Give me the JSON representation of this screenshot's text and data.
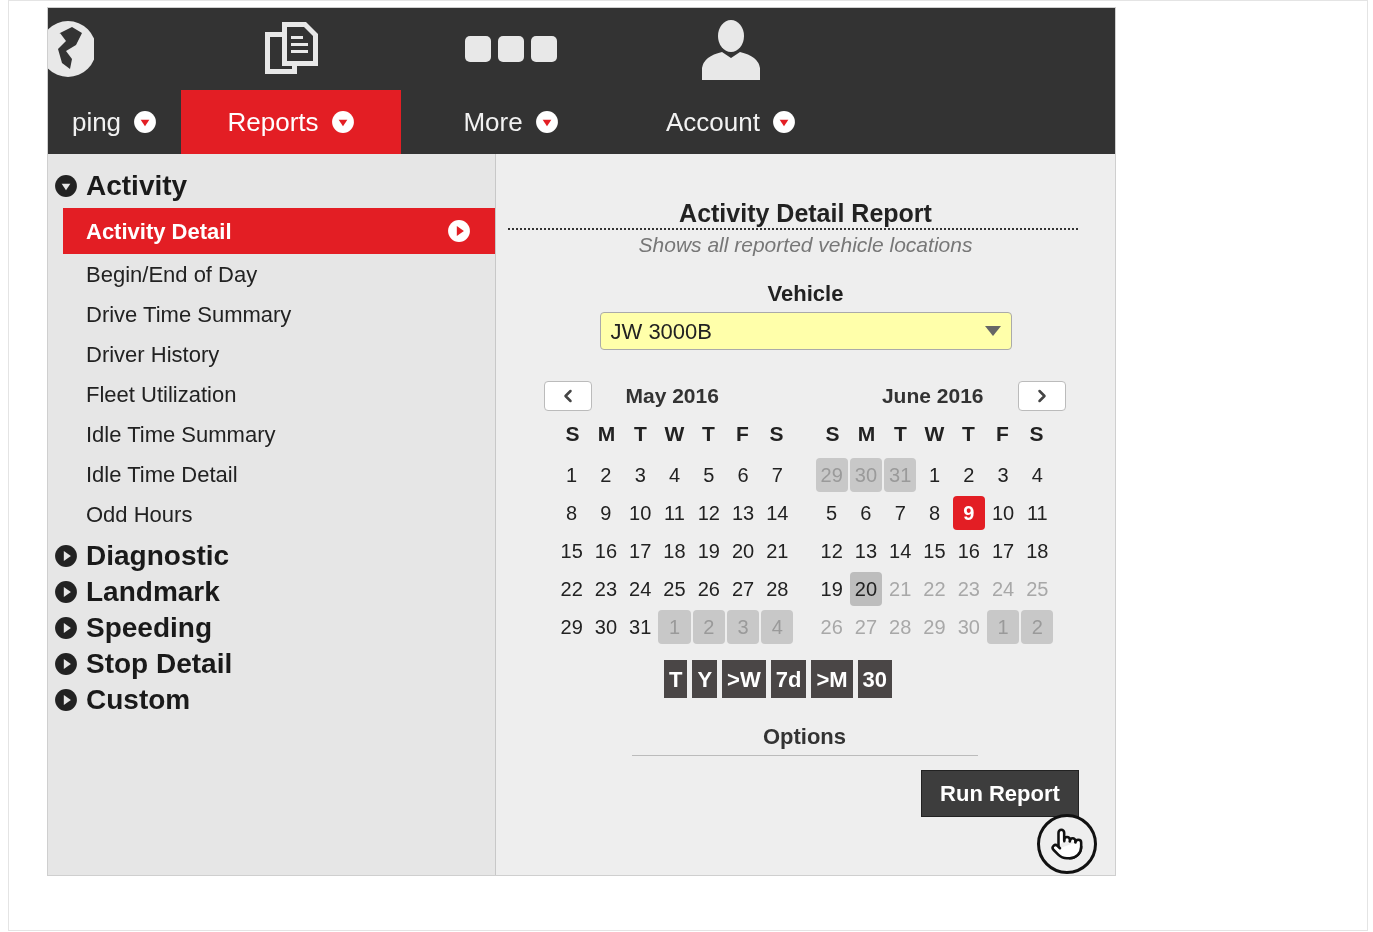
{
  "nav": [
    {
      "label": "ping",
      "selected": false
    },
    {
      "label": "Reports",
      "selected": true
    },
    {
      "label": "More",
      "selected": false
    },
    {
      "label": "Account",
      "selected": false
    }
  ],
  "sidebar": [
    {
      "label": "Activity",
      "expanded": true,
      "children": [
        {
          "label": "Activity Detail",
          "selected": true
        },
        {
          "label": "Begin/End of Day",
          "selected": false
        },
        {
          "label": "Drive Time Summary",
          "selected": false
        },
        {
          "label": "Driver History",
          "selected": false
        },
        {
          "label": "Fleet Utilization",
          "selected": false
        },
        {
          "label": "Idle Time Summary",
          "selected": false
        },
        {
          "label": "Idle Time Detail",
          "selected": false
        },
        {
          "label": "Odd Hours",
          "selected": false
        }
      ]
    },
    {
      "label": "Diagnostic",
      "expanded": false
    },
    {
      "label": "Landmark",
      "expanded": false
    },
    {
      "label": "Speeding",
      "expanded": false
    },
    {
      "label": "Stop Detail",
      "expanded": false
    },
    {
      "label": "Custom",
      "expanded": false
    }
  ],
  "report": {
    "title": "Activity Detail Report",
    "subtitle": "Shows all reported vehicle locations",
    "vehicle_label": "Vehicle",
    "vehicle_value": "JW 3000B"
  },
  "calendar": {
    "months": [
      {
        "title": "May 2016",
        "weekdays": [
          "S",
          "M",
          "T",
          "W",
          "T",
          "F",
          "S"
        ],
        "weeks": [
          [
            {
              "day": "1",
              "kind": "normal"
            },
            {
              "day": "2",
              "kind": "normal"
            },
            {
              "day": "3",
              "kind": "normal"
            },
            {
              "day": "4",
              "kind": "normal"
            },
            {
              "day": "5",
              "kind": "normal"
            },
            {
              "day": "6",
              "kind": "normal"
            },
            {
              "day": "7",
              "kind": "normal"
            }
          ],
          [
            {
              "day": "8",
              "kind": "normal"
            },
            {
              "day": "9",
              "kind": "normal"
            },
            {
              "day": "10",
              "kind": "normal"
            },
            {
              "day": "11",
              "kind": "normal"
            },
            {
              "day": "12",
              "kind": "normal"
            },
            {
              "day": "13",
              "kind": "normal"
            },
            {
              "day": "14",
              "kind": "normal"
            }
          ],
          [
            {
              "day": "15",
              "kind": "normal"
            },
            {
              "day": "16",
              "kind": "normal"
            },
            {
              "day": "17",
              "kind": "normal"
            },
            {
              "day": "18",
              "kind": "normal"
            },
            {
              "day": "19",
              "kind": "normal"
            },
            {
              "day": "20",
              "kind": "normal"
            },
            {
              "day": "21",
              "kind": "normal"
            }
          ],
          [
            {
              "day": "22",
              "kind": "normal"
            },
            {
              "day": "23",
              "kind": "normal"
            },
            {
              "day": "24",
              "kind": "normal"
            },
            {
              "day": "25",
              "kind": "normal"
            },
            {
              "day": "26",
              "kind": "normal"
            },
            {
              "day": "27",
              "kind": "normal"
            },
            {
              "day": "28",
              "kind": "normal"
            }
          ],
          [
            {
              "day": "29",
              "kind": "normal"
            },
            {
              "day": "30",
              "kind": "normal"
            },
            {
              "day": "31",
              "kind": "normal"
            },
            {
              "day": "1",
              "kind": "other"
            },
            {
              "day": "2",
              "kind": "other"
            },
            {
              "day": "3",
              "kind": "other"
            },
            {
              "day": "4",
              "kind": "other"
            }
          ]
        ]
      },
      {
        "title": "June 2016",
        "weekdays": [
          "S",
          "M",
          "T",
          "W",
          "T",
          "F",
          "S"
        ],
        "weeks": [
          [
            {
              "day": "29",
              "kind": "other"
            },
            {
              "day": "30",
              "kind": "other"
            },
            {
              "day": "31",
              "kind": "other"
            },
            {
              "day": "1",
              "kind": "normal"
            },
            {
              "day": "2",
              "kind": "normal"
            },
            {
              "day": "3",
              "kind": "normal"
            },
            {
              "day": "4",
              "kind": "normal"
            }
          ],
          [
            {
              "day": "5",
              "kind": "normal"
            },
            {
              "day": "6",
              "kind": "normal"
            },
            {
              "day": "7",
              "kind": "normal"
            },
            {
              "day": "8",
              "kind": "normal"
            },
            {
              "day": "9",
              "kind": "selected"
            },
            {
              "day": "10",
              "kind": "normal"
            },
            {
              "day": "11",
              "kind": "normal"
            }
          ],
          [
            {
              "day": "12",
              "kind": "normal"
            },
            {
              "day": "13",
              "kind": "normal"
            },
            {
              "day": "14",
              "kind": "normal"
            },
            {
              "day": "15",
              "kind": "normal"
            },
            {
              "day": "16",
              "kind": "normal"
            },
            {
              "day": "17",
              "kind": "normal"
            },
            {
              "day": "18",
              "kind": "normal"
            }
          ],
          [
            {
              "day": "19",
              "kind": "normal"
            },
            {
              "day": "20",
              "kind": "today"
            },
            {
              "day": "21",
              "kind": "disabled"
            },
            {
              "day": "22",
              "kind": "disabled"
            },
            {
              "day": "23",
              "kind": "disabled"
            },
            {
              "day": "24",
              "kind": "disabled"
            },
            {
              "day": "25",
              "kind": "disabled"
            }
          ],
          [
            {
              "day": "26",
              "kind": "disabled"
            },
            {
              "day": "27",
              "kind": "disabled"
            },
            {
              "day": "28",
              "kind": "disabled"
            },
            {
              "day": "29",
              "kind": "disabled"
            },
            {
              "day": "30",
              "kind": "disabled"
            },
            {
              "day": "1",
              "kind": "other"
            },
            {
              "day": "2",
              "kind": "other"
            }
          ]
        ]
      }
    ],
    "quick_ranges": [
      "T",
      "Y",
      ">W",
      "7d",
      ">M",
      "30"
    ]
  },
  "options_label": "Options",
  "run_button": "Run Report"
}
